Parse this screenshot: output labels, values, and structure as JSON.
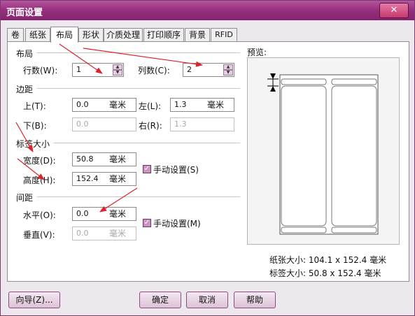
{
  "window": {
    "title": "页面设置",
    "close_label": "✕"
  },
  "tabs": [
    {
      "label": "卷"
    },
    {
      "label": "纸张"
    },
    {
      "label": "布局",
      "active": true
    },
    {
      "label": "形状"
    },
    {
      "label": "介质处理"
    },
    {
      "label": "打印顺序"
    },
    {
      "label": "背景"
    },
    {
      "label": "RFID"
    }
  ],
  "layout": {
    "section": "布局",
    "rows_label": "行数(W):",
    "rows_value": "1",
    "cols_label": "列数(C):",
    "cols_value": "2"
  },
  "margins": {
    "section": "边距",
    "top_label": "上(T):",
    "top_value": "0.0",
    "top_unit": "毫米",
    "left_label": "左(L):",
    "left_value": "1.3",
    "left_unit": "毫米",
    "bottom_label": "下(B):",
    "bottom_value": "0.0",
    "right_label": "右(R):",
    "right_value": "1.3"
  },
  "label_size": {
    "section": "标签大小",
    "width_label": "宽度(D):",
    "width_value": "50.8",
    "width_unit": "毫米",
    "height_label": "高度(H):",
    "height_value": "152.4",
    "height_unit": "毫米",
    "manual_label": "手动设置(S)",
    "manual_checked": true
  },
  "spacing": {
    "section": "间距",
    "horizontal_label": "水平(O):",
    "horizontal_value": "0.0",
    "horizontal_unit": "毫米",
    "vertical_label": "垂直(V):",
    "vertical_value": "0.0",
    "vertical_unit": "毫米",
    "manual_label": "手动设置(M)",
    "manual_checked": true
  },
  "preview": {
    "title": "预览:",
    "paper_size": "纸张大小:  104.1 x 152.4  毫米",
    "label_size": "标签大小:  50.8 x 152.4  毫米"
  },
  "buttons": {
    "wizard": "向导(Z)...",
    "ok": "确定",
    "cancel": "取消",
    "help": "帮助"
  },
  "colors": {
    "title_bar": "#98317f",
    "annotation_arrow": "#e0202a"
  }
}
